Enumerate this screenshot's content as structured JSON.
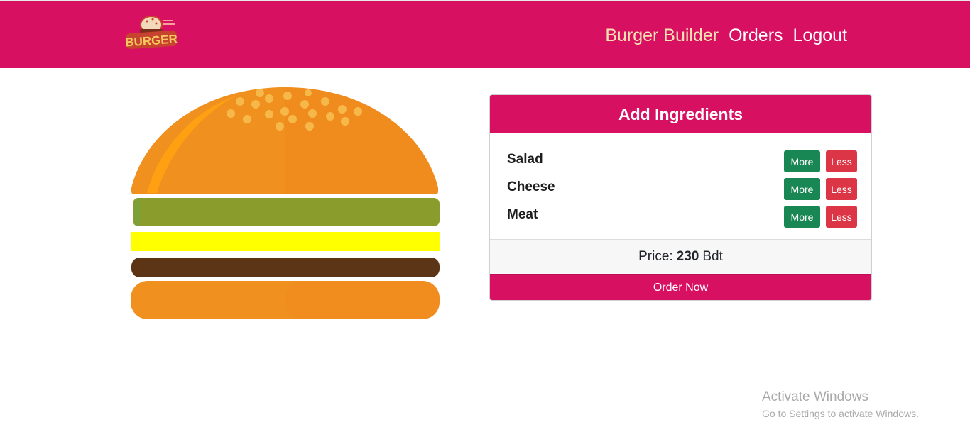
{
  "navbar": {
    "logo_text": "BURGER",
    "links": [
      {
        "label": "Burger Builder",
        "active": true
      },
      {
        "label": "Orders",
        "active": false
      },
      {
        "label": "Logout",
        "active": false
      }
    ],
    "brand_color": "#d81062",
    "active_link_color": "#f4e3b1"
  },
  "burger": {
    "layers": [
      "bread-top",
      "salad",
      "cheese",
      "meat",
      "bread-bottom"
    ],
    "colors": {
      "bun": "#f0901e",
      "salad": "#8a9c2b",
      "cheese": "#ffff00",
      "meat": "#5c3516"
    }
  },
  "builder": {
    "title": "Add Ingredients",
    "ingredients": [
      {
        "label": "Salad",
        "more": "More",
        "less": "Less"
      },
      {
        "label": "Cheese",
        "more": "More",
        "less": "Less"
      },
      {
        "label": "Meat",
        "more": "More",
        "less": "Less"
      }
    ],
    "price_label": "Price:",
    "price_value": "230",
    "price_currency": "Bdt",
    "order_button": "Order Now"
  },
  "watermark": {
    "line1": "Activate Windows",
    "line2": "Go to Settings to activate Windows."
  }
}
